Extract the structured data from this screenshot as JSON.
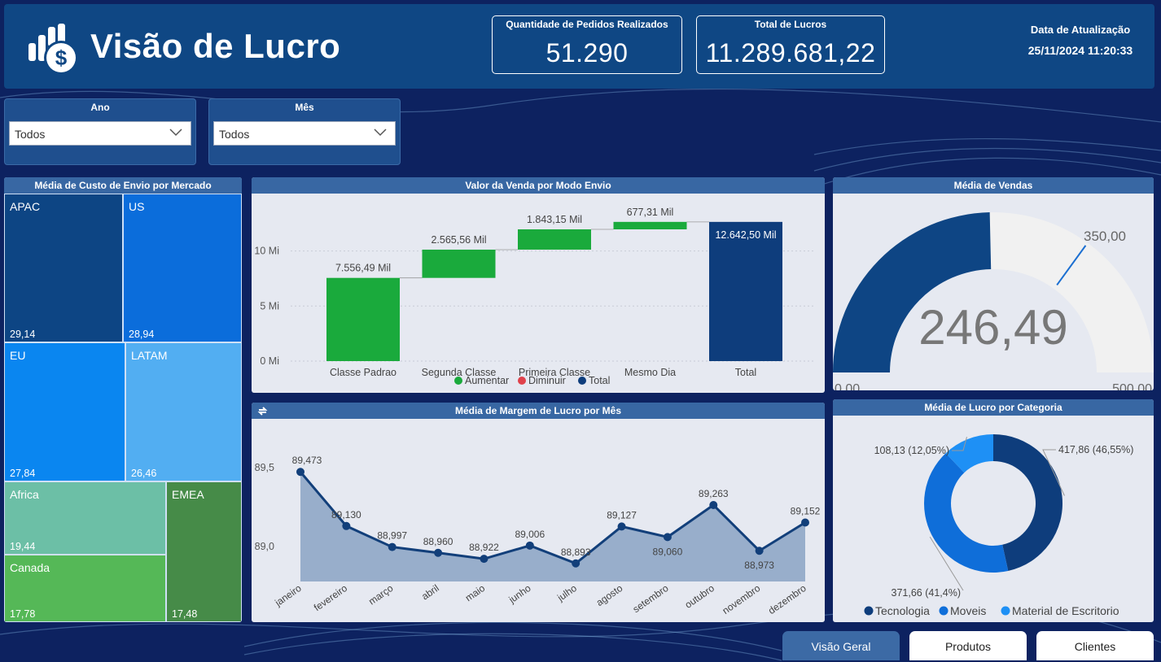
{
  "header": {
    "title": "Visão de Lucro",
    "kpi_orders_label": "Quantidade de Pedidos Realizados",
    "kpi_orders_value": "51.290",
    "kpi_profit_label": "Total de Lucros",
    "kpi_profit_value": "11.289.681,22",
    "update_label": "Data de Atualização",
    "update_value": "25/11/2024 11:20:33"
  },
  "filters": {
    "year": {
      "label": "Ano",
      "value": "Todos"
    },
    "month": {
      "label": "Mês",
      "value": "Todos"
    }
  },
  "treemap": {
    "title": "Média de Custo de Envio por Mercado",
    "cells": [
      {
        "name": "APAC",
        "value": "29,14",
        "color": "#0d4584"
      },
      {
        "name": "US",
        "value": "28,94",
        "color": "#0b6ddb"
      },
      {
        "name": "EU",
        "value": "27,84",
        "color": "#0a86f0"
      },
      {
        "name": "LATAM",
        "value": "26,46",
        "color": "#52aef2"
      },
      {
        "name": "Africa",
        "value": "19,44",
        "color": "#6cbfa6"
      },
      {
        "name": "EMEA",
        "value": "17,48",
        "color": "#468b48"
      },
      {
        "name": "Canada",
        "value": "17,78",
        "color": "#55b857"
      }
    ]
  },
  "waterfall": {
    "title": "Valor da Venda por Modo Envio",
    "y_ticks": [
      "0 Mi",
      "5 Mi",
      "10 Mi"
    ],
    "legend": [
      "Aumentar",
      "Diminuir",
      "Total"
    ],
    "colors": {
      "increase": "#1aaa3c",
      "decrease": "#e0424b",
      "total": "#0e3d7c"
    }
  },
  "gauge": {
    "title": "Média de Vendas",
    "value": "246,49",
    "min_label": "0,00",
    "max_label": "500,00",
    "target_label": "350,00"
  },
  "line": {
    "title": "Média de Margem de Lucro por Mês",
    "y_ticks": [
      "89,0",
      "89,5"
    ]
  },
  "donut": {
    "title": "Média de Lucro por Categoria",
    "labels": [
      "417,86 (46,55%)",
      "371,66 (41,4%)",
      "108,13 (12,05%)"
    ]
  },
  "tabs": [
    "Visão Geral",
    "Produtos",
    "Clientes"
  ],
  "chart_data": [
    {
      "type": "treemap",
      "title": "Média de Custo de Envio por Mercado",
      "categories": [
        "APAC",
        "US",
        "EU",
        "LATAM",
        "Africa",
        "Canada",
        "EMEA"
      ],
      "values": [
        29.14,
        28.94,
        27.84,
        26.46,
        19.44,
        17.78,
        17.48
      ]
    },
    {
      "type": "bar",
      "subtype": "waterfall",
      "title": "Valor da Venda por Modo Envio",
      "categories": [
        "Classe Padrao",
        "Segunda Classe",
        "Primeira Classe",
        "Mesmo Dia",
        "Total"
      ],
      "values": [
        7556.49,
        2565.56,
        1843.15,
        677.31,
        12642.5
      ],
      "data_labels": [
        "7.556,49 Mil",
        "2.565,56 Mil",
        "1.843,15 Mil",
        "677,31 Mil",
        "12.642,50 Mil"
      ],
      "ylim": [
        0,
        13000
      ],
      "legend": [
        "Aumentar",
        "Diminuir",
        "Total"
      ]
    },
    {
      "type": "gauge",
      "title": "Média de Vendas",
      "value": 246.49,
      "min": 0,
      "max": 500,
      "target": 350
    },
    {
      "type": "area",
      "title": "Média de Margem de Lucro por Mês",
      "categories": [
        "janeiro",
        "fevereiro",
        "março",
        "abril",
        "maio",
        "junho",
        "julho",
        "agosto",
        "setembro",
        "outubro",
        "novembro",
        "dezembro"
      ],
      "values": [
        89.473,
        89.13,
        88.997,
        88.96,
        88.922,
        89.006,
        88.893,
        89.127,
        89.06,
        89.263,
        88.973,
        89.152
      ],
      "data_labels": [
        "89,473",
        "89,130",
        "88,997",
        "88,960",
        "88,922",
        "89,006",
        "88,893",
        "89,127",
        "89,060",
        "89,263",
        "88,973",
        "89,152"
      ],
      "ylim": [
        88.8,
        89.55
      ]
    },
    {
      "type": "pie",
      "subtype": "donut",
      "title": "Média de Lucro por Categoria",
      "categories": [
        "Tecnologia",
        "Moveis",
        "Material de Escritorio"
      ],
      "values": [
        417.86,
        371.66,
        108.13
      ],
      "percent": [
        46.55,
        41.4,
        12.05
      ],
      "colors": [
        "#0e3d7c",
        "#0f6ed9",
        "#1e90f5"
      ],
      "legend": "bottom"
    }
  ]
}
